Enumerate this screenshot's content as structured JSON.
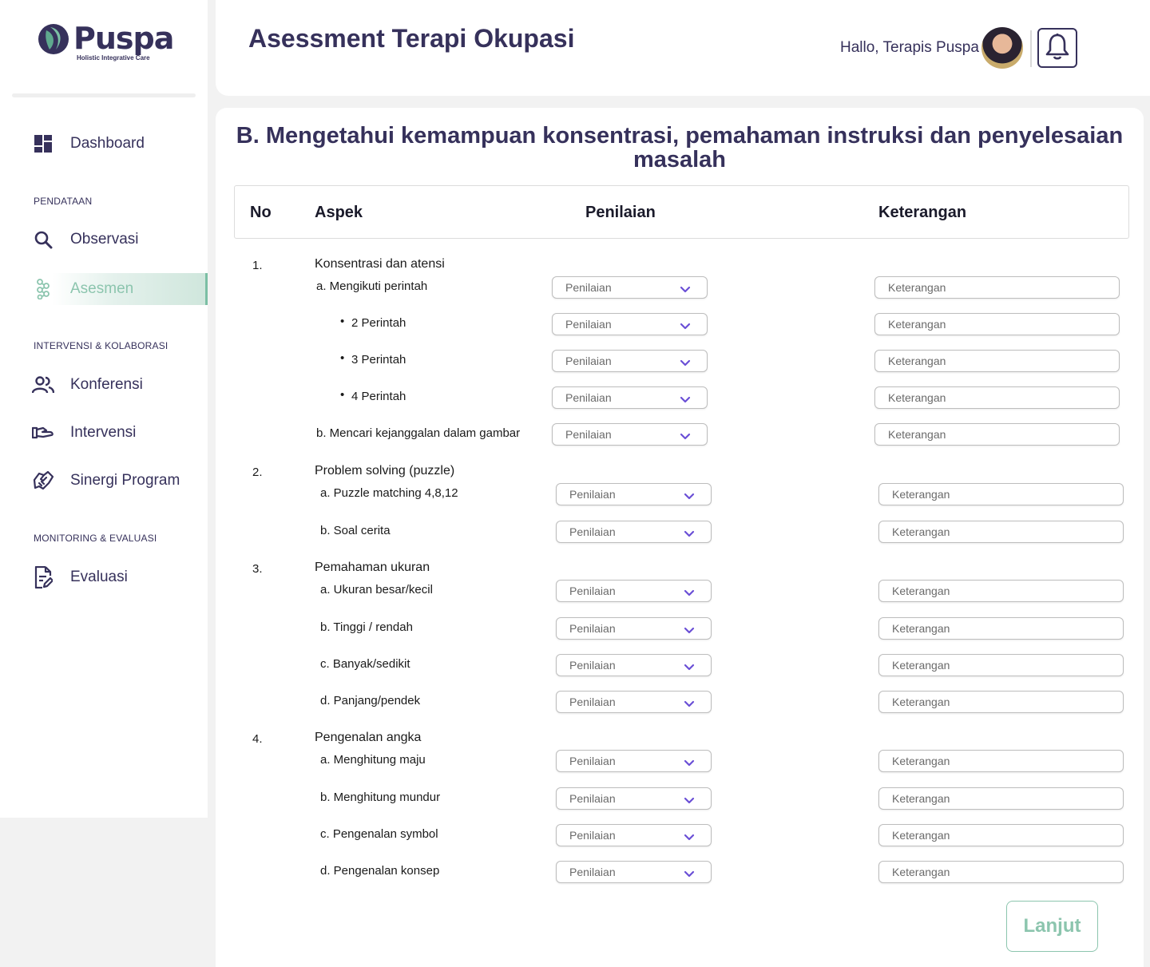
{
  "brand": {
    "name": "Puspa",
    "tagline": "Holistic Integrative Care"
  },
  "sidebar": {
    "items": [
      {
        "label": "Dashboard",
        "icon": "dashboard-icon"
      },
      {
        "label": "Observasi",
        "icon": "search-icon"
      },
      {
        "label": "Asesmen",
        "icon": "asesmen-icon",
        "active": true
      },
      {
        "label": "Konferensi",
        "icon": "people-icon"
      },
      {
        "label": "Intervensi",
        "icon": "hand-icon"
      },
      {
        "label": "Sinergi Program",
        "icon": "handshake-icon"
      },
      {
        "label": "Evaluasi",
        "icon": "document-edit-icon"
      }
    ],
    "sections": [
      "PENDATAAN",
      "INTERVENSI & KOLABORASI",
      "MONITORING & EVALUASI"
    ]
  },
  "header": {
    "title": "Asessment Terapi Okupasi",
    "greeting": "Hallo, Terapis Puspa"
  },
  "main": {
    "section_title": "B. Mengetahui kemampuan konsentrasi, pemahaman instruksi dan penyelesaian masalah",
    "columns": [
      "No",
      "Aspek",
      "Penilaian",
      "Keterangan"
    ],
    "select_placeholder": "Penilaian",
    "input_placeholder": "Keterangan",
    "groups": [
      {
        "no": "1.",
        "title": "Konsentrasi dan atensi",
        "rows": [
          "a. Mengikuti perintah",
          "2 Perintah",
          "3 Perintah",
          "4 Perintah",
          "b. Mencari kejanggalan dalam gambar"
        ]
      },
      {
        "no": "2.",
        "title": "Problem solving (puzzle)",
        "rows": [
          "a. Puzzle matching 4,8,12",
          "b. Soal cerita"
        ]
      },
      {
        "no": "3.",
        "title": "Pemahaman ukuran",
        "rows": [
          "a. Ukuran besar/kecil",
          "b. Tinggi / rendah",
          "c. Banyak/sedikit",
          "d. Panjang/pendek"
        ]
      },
      {
        "no": "4.",
        "title": "Pengenalan angka",
        "rows": [
          "a. Menghitung maju",
          "b. Menghitung mundur",
          "c. Pengenalan symbol",
          "d. Pengenalan konsep"
        ]
      }
    ],
    "next_label": "Lanjut"
  },
  "colors": {
    "primary": "#36315b",
    "accent": "#8cc5ae",
    "active_bg": "#cfe6dc"
  }
}
